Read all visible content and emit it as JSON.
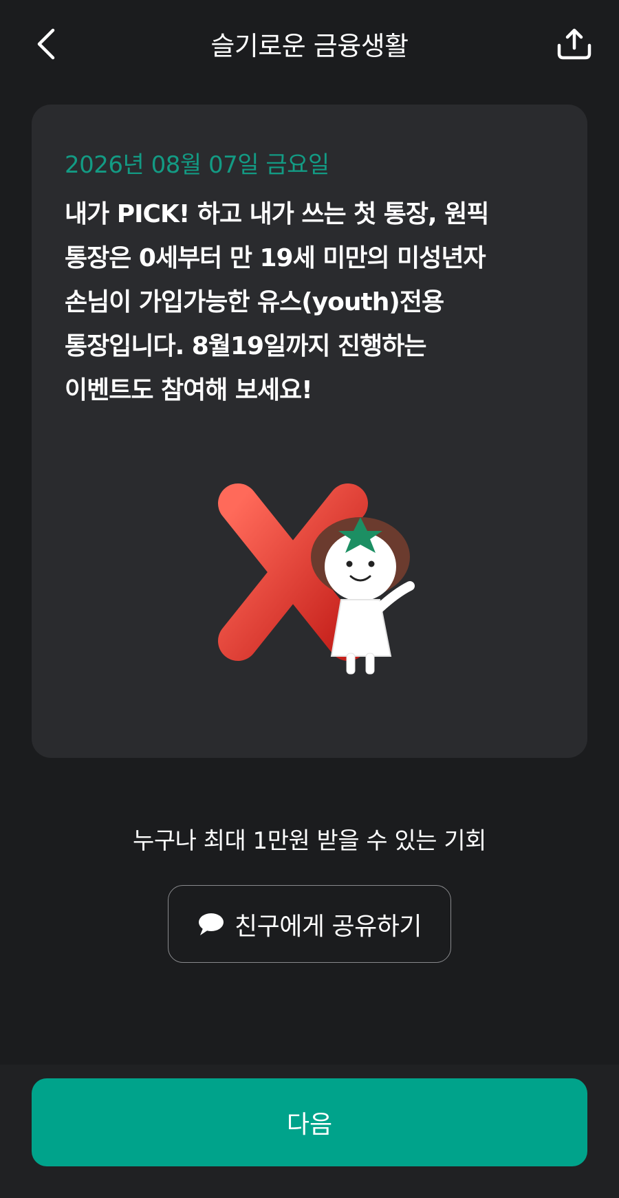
{
  "header": {
    "title": "슬기로운 금융생활",
    "back_icon": "chevron-left-icon",
    "share_icon": "share-upload-icon"
  },
  "card": {
    "date": "2026년 08월 07일 금요일",
    "lines": [
      "내가 PICK! 하고 내가 쓰는 첫 통장, 원픽",
      "통장은 0세부터 만 19세 미만의 미성년자",
      "손님이 가입가능한 유스(youth)전용",
      "통장입니다. 8월19일까지 진행하는",
      "이벤트도 참여해 보세요!"
    ],
    "illustration": "red-x-with-character"
  },
  "subtitle": "누구나 최대 1만원 받을 수 있는 기회",
  "share_friend": {
    "label": "친구에게 공유하기",
    "icon": "speech-bubble-icon"
  },
  "bottom": {
    "next_label": "다음"
  },
  "colors": {
    "background": "#1b1c1e",
    "card": "#2a2b2e",
    "accent": "#00a38b",
    "date_text": "#139b84"
  }
}
